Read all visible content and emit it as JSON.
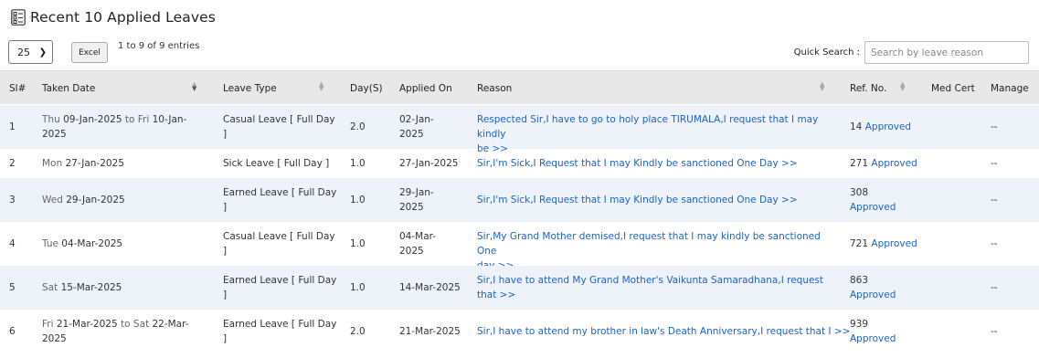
{
  "header": {
    "title": "Recent 10 Applied Leaves"
  },
  "controls": {
    "page_size": "25",
    "excel_label": "Excel",
    "entries_info": "1 to 9 of 9 entries",
    "quick_search_label": "Quick Search :",
    "quick_search_placeholder": "Search by leave reason"
  },
  "columns": {
    "sl": "Sl#",
    "taken_date": "Taken Date",
    "leave_type": "Leave Type",
    "days": "Day(S)",
    "applied_on": "Applied On",
    "reason": "Reason",
    "ref_no": "Ref. No.",
    "med_cert": "Med Cert",
    "manage": "Manage"
  },
  "rows": [
    {
      "sl": "1",
      "day1": "Thu",
      "date1": "09-Jan-2025",
      "to": "to",
      "day2": "Fri",
      "date2a": "10-Jan-",
      "date2b": "2025",
      "leave_type_a": "Casual Leave [ Full Day",
      "leave_type_b": "]",
      "days": "2.0",
      "applied_a": "02-Jan-",
      "applied_b": "2025",
      "reason_a": "Respected Sir,I have to go to holy place TIRUMALA,I request that I may kindly",
      "reason_b": "be >>",
      "ref": "14",
      "status": "Approved",
      "manage": "--"
    },
    {
      "sl": "2",
      "day1": "Mon",
      "date1": "27-Jan-2025",
      "leave_type_a": "Sick Leave [ Full Day ]",
      "days": "1.0",
      "applied_a": "27-Jan-2025",
      "reason_a": "Sir,I'm Sick,I Request that I may Kindly be sanctioned One Day >>",
      "ref": "271",
      "status": "Approved",
      "manage": "--"
    },
    {
      "sl": "3",
      "day1": "Wed",
      "date1": "29-Jan-2025",
      "leave_type_a": "Earned Leave [ Full Day",
      "leave_type_b": "]",
      "days": "1.0",
      "applied_a": "29-Jan-",
      "applied_b": "2025",
      "reason_a": "Sir,I'm Sick,I Request that I may Kindly be sanctioned One Day >>",
      "ref": "308",
      "status": "Approved",
      "manage": "--"
    },
    {
      "sl": "4",
      "day1": "Tue",
      "date1": "04-Mar-2025",
      "leave_type_a": "Casual Leave [ Full Day",
      "leave_type_b": "]",
      "days": "1.0",
      "applied_a": "04-Mar-",
      "applied_b": "2025",
      "reason_a": "Sir,My Grand Mother demised,I request that I may kindly be sanctioned One",
      "reason_b": "day >>",
      "ref": "721",
      "status": "Approved",
      "manage": "--"
    },
    {
      "sl": "5",
      "day1": "Sat",
      "date1": "15-Mar-2025",
      "leave_type_a": "Earned Leave [ Full Day",
      "leave_type_b": "]",
      "days": "1.0",
      "applied_a": "14-Mar-2025",
      "reason_a": "Sir,I have to attend My Grand Mother's Vaikunta Samaradhana,I request",
      "reason_b": "that >>",
      "ref": "863",
      "status": "Approved",
      "manage": "--"
    },
    {
      "sl": "6",
      "day1": "Fri",
      "date1": "21-Mar-2025",
      "to": "to",
      "day2": "Sat",
      "date2a": "22-Mar-",
      "date2b": "2025",
      "leave_type_a": "Earned Leave [ Full Day",
      "leave_type_b": "]",
      "days": "2.0",
      "applied_a": "21-Mar-2025",
      "reason_a": "Sir,I have to attend my brother in law's Death Anniversary,I request that I >>",
      "ref": "939",
      "status": "Approved",
      "manage": "--"
    }
  ]
}
